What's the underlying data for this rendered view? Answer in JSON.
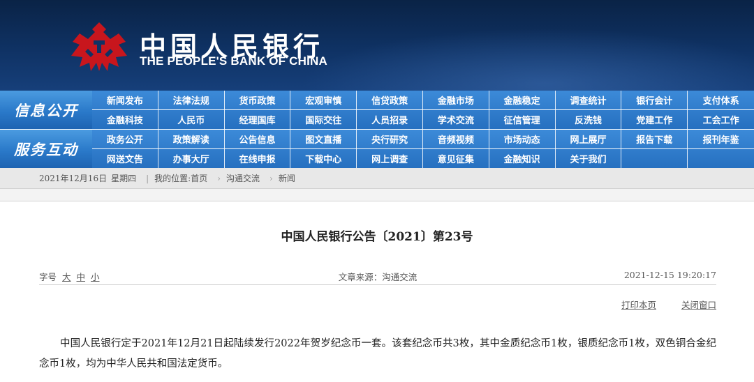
{
  "header": {
    "title_cn": "中国人民银行",
    "title_en": "THE PEOPLE'S BANK OF CHINA",
    "emblem_color": "#c8161d"
  },
  "nav": {
    "groups": [
      {
        "label": "信息公开",
        "rows": [
          [
            "新闻发布",
            "法律法规",
            "货币政策",
            "宏观审慎",
            "信贷政策",
            "金融市场",
            "金融稳定",
            "调查统计",
            "银行会计",
            "支付体系"
          ],
          [
            "金融科技",
            "人民币",
            "经理国库",
            "国际交往",
            "人员招录",
            "学术交流",
            "征信管理",
            "反洗钱",
            "党建工作",
            "工会工作"
          ]
        ]
      },
      {
        "label": "服务互动",
        "rows": [
          [
            "政务公开",
            "政策解读",
            "公告信息",
            "图文直播",
            "央行研究",
            "音频视频",
            "市场动态",
            "网上展厅",
            "报告下载",
            "报刊年鉴"
          ],
          [
            "网送文告",
            "办事大厅",
            "在线申报",
            "下载中心",
            "网上调查",
            "意见征集",
            "金融知识",
            "关于我们"
          ]
        ]
      }
    ]
  },
  "breadcrumb": {
    "date": "2021年12月16日",
    "weekday": "星期四",
    "location_label": "我的位置:",
    "items": [
      "首页",
      "沟通交流",
      "新闻"
    ],
    "separator": "›"
  },
  "article": {
    "title": "中国人民银行公告〔2021〕第23号",
    "font_size_label": "字号",
    "sizes": [
      "大",
      "中",
      "小"
    ],
    "source": "文章来源：沟通交流",
    "datetime": "2021-12-15 19:20:17",
    "print_label": "打印本页",
    "close_label": "关闭窗口",
    "body": "中国人民银行定于2021年12月21日起陆续发行2022年贺岁纪念币一套。该套纪念币共3枚，其中金质纪念币1枚，银质纪念币1枚，双色铜合金纪念币1枚，均为中华人民共和国法定货币。"
  }
}
